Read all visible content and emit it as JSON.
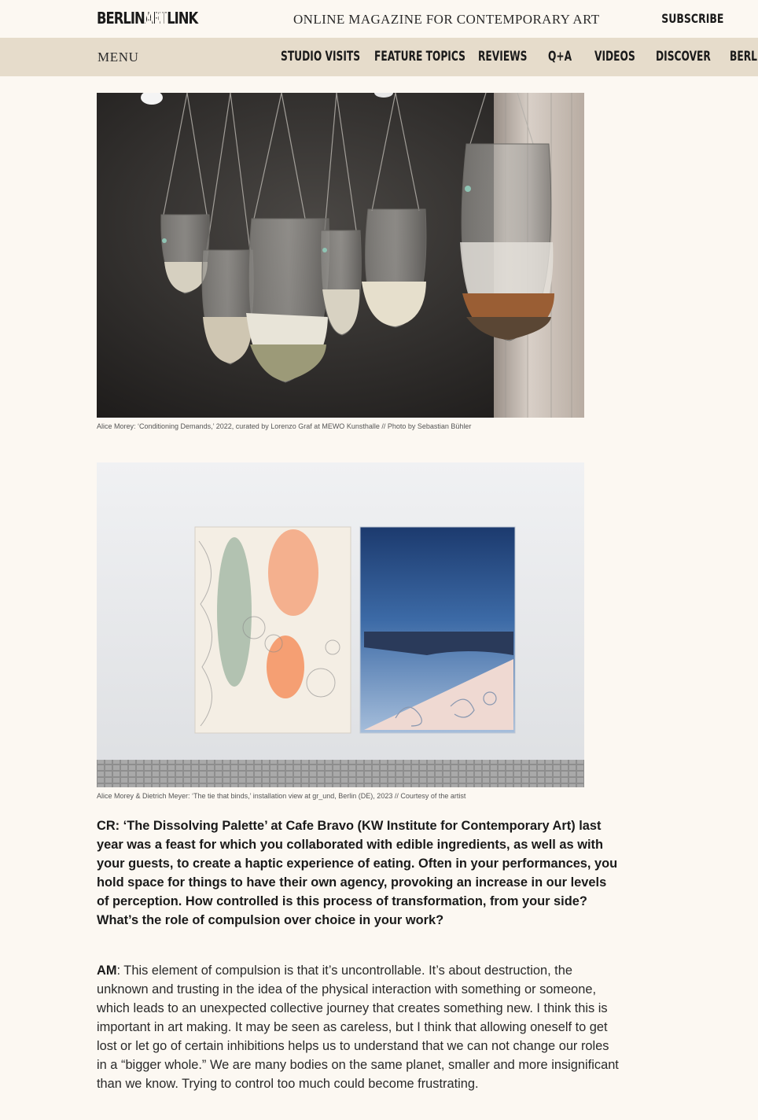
{
  "header": {
    "logo_part1": "BERLIN",
    "logo_part2": "ART",
    "logo_part3": "LINK",
    "tagline": "ONLINE MAGAZINE FOR CONTEMPORARY ART",
    "subscribe_label": "SUBSCRIBE"
  },
  "nav": {
    "menu_label": "MENU",
    "items": [
      {
        "label": "STUDIO VISITS"
      },
      {
        "label": "FEATURE TOPICS"
      },
      {
        "label": "REVIEWS"
      },
      {
        "label": "Q+A"
      },
      {
        "label": "VIDEOS"
      },
      {
        "label": "DISCOVER"
      },
      {
        "label": "BERLIN"
      }
    ]
  },
  "figures": [
    {
      "caption": "Alice Morey: ‘Conditioning Demands,’ 2022, curated by Lorenzo Graf at MEWO Kunsthalle // Photo by Sebastian Bühler"
    },
    {
      "caption": "Alice Morey & Dietrich Meyer: ‘The tie that binds,’ installation view at gr_und, Berlin (DE), 2023 // Courtesy of the artist"
    }
  ],
  "article": {
    "question": "CR: ‘The Dissolving Palette’ at Cafe Bravo (KW Institute for Contemporary Art) last year was a feast for which you collaborated with edible ingredients, as well as with your guests, to create a haptic experience of eating. Often in your performances, you hold space for things to have their own agency, provoking an increase in our levels of perception. How controlled is this process of transformation, from your side? What’s the role of compulsion over choice in your work?",
    "answer_speaker": "AM",
    "answer_text": ": This element of compulsion is that it’s uncontrollable. It’s about destruction, the unknown and trusting in the idea of the physical interaction with something or someone, which leads to an unexpected collective journey that creates something new. I think this is important in art making. It may be seen as careless, but I think that allowing oneself to get lost or let go of certain inhibitions helps us to understand that we can not change our roles in a “bigger whole.” We are many bodies on the same planet, smaller and more insignificant than we know. Trying to control too much could become frustrating."
  }
}
